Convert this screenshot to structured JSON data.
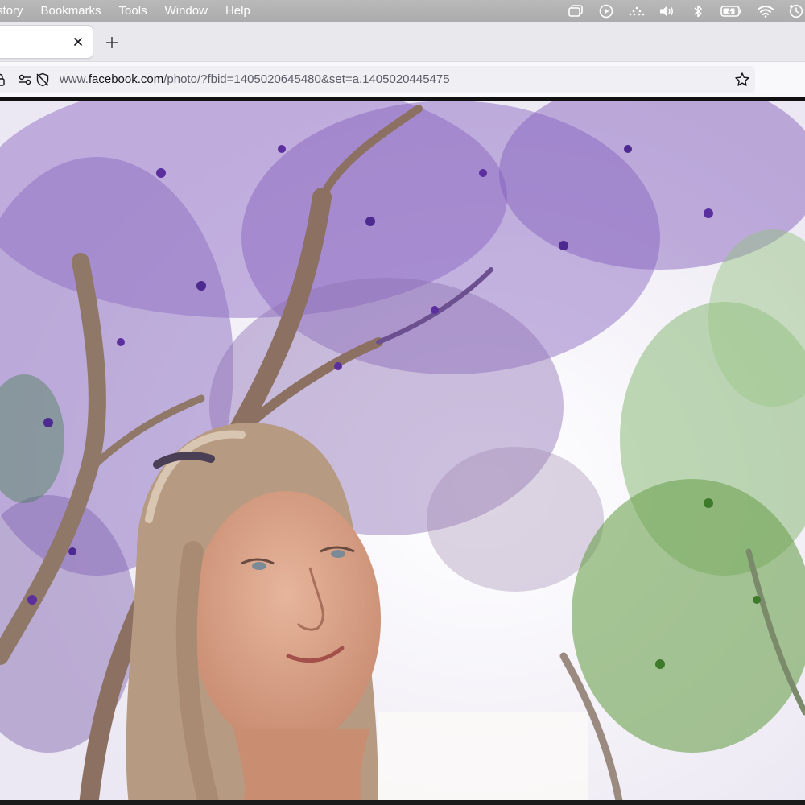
{
  "menubar": {
    "items": [
      "story",
      "Bookmarks",
      "Tools",
      "Window",
      "Help"
    ],
    "status_icons": [
      "window-icon",
      "play-icon",
      "dots-icon",
      "volume-icon",
      "bluetooth-icon",
      "battery-icon",
      "wifi-icon",
      "clock-icon"
    ]
  },
  "tabs": {
    "close_icon": "close-icon",
    "new_tab_icon": "plus-icon"
  },
  "urlbar": {
    "url_prefix": "www.",
    "url_domain": "facebook.com",
    "url_path": "/photo/?fbid=1405020645480&set=a.1405020445475"
  },
  "colors": {
    "menubar": "#b3b3b3",
    "tabstrip": "#e9e9ed",
    "urlbar": "#f0f0f4",
    "sky": "#f4f2f7",
    "foliage_purple": "#6a3fb0",
    "foliage_green": "#5d9a3c"
  }
}
